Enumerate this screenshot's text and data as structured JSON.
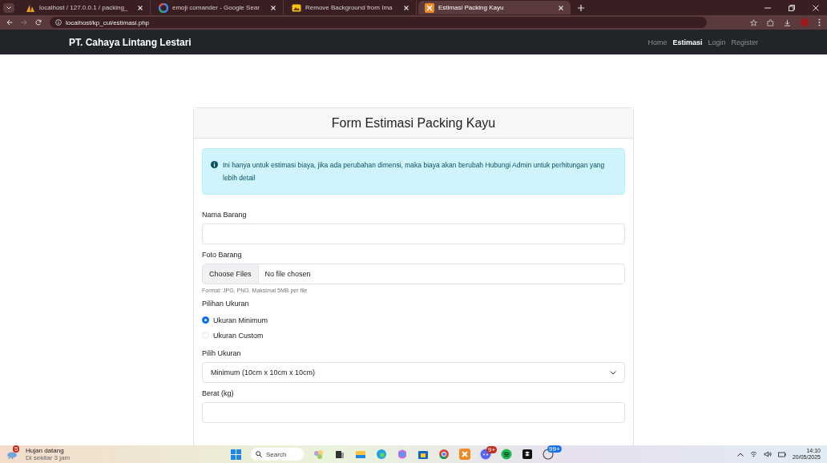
{
  "browser": {
    "tabs": [
      {
        "title": "localhost / 127.0.0.1 / packing_",
        "selected": false
      },
      {
        "title": "emoji comander - Google Sear",
        "selected": false
      },
      {
        "title": "Remove Background from Ima",
        "selected": false
      },
      {
        "title": "Estimasi Packing Kayu",
        "selected": true
      }
    ],
    "url": "localhost/kp_cui/estimasi.php"
  },
  "navbar": {
    "brand": "PT. Cahaya Lintang Lestari",
    "links": [
      {
        "label": "Home",
        "selected": false
      },
      {
        "label": "Estimasi",
        "selected": true
      },
      {
        "label": "Login",
        "selected": false
      },
      {
        "label": "Register",
        "selected": false
      }
    ]
  },
  "card": {
    "title": "Form Estimasi Packing Kayu",
    "alert": "Ini hanya untuk estimasi biaya, jika ada perubahan dimensi, maka biaya akan berubah Hubungi Admin untuk perhitungan yang lebih detail",
    "fields": [
      {
        "kind": "text",
        "label": "Nama Barang"
      },
      {
        "kind": "file",
        "label": "Foto Barang",
        "button": "Choose Files",
        "value": "No file chosen",
        "hint": "Format: JPG, PNG. Maksimal 5MB per file"
      },
      {
        "kind": "radio",
        "label": "Pilihan Ukuran",
        "options": [
          {
            "label": "Ukuran Minimum",
            "selected": true
          },
          {
            "label": "Ukuran Custom",
            "selected": false
          }
        ]
      },
      {
        "kind": "select",
        "label": "Pilih Ukuran",
        "value": "Minimum (10cm x 10cm x 10cm)"
      },
      {
        "kind": "text",
        "label": "Berat (kg)"
      }
    ]
  },
  "taskbar": {
    "weather": {
      "badge": "5",
      "title": "Hujan datang",
      "subtitle": "Di sekitar 3 jam"
    },
    "search": "Search",
    "badges": {
      "discord": "9+",
      "whatsapp": "99+"
    },
    "time": "14:10",
    "date": "20/05/2025"
  }
}
